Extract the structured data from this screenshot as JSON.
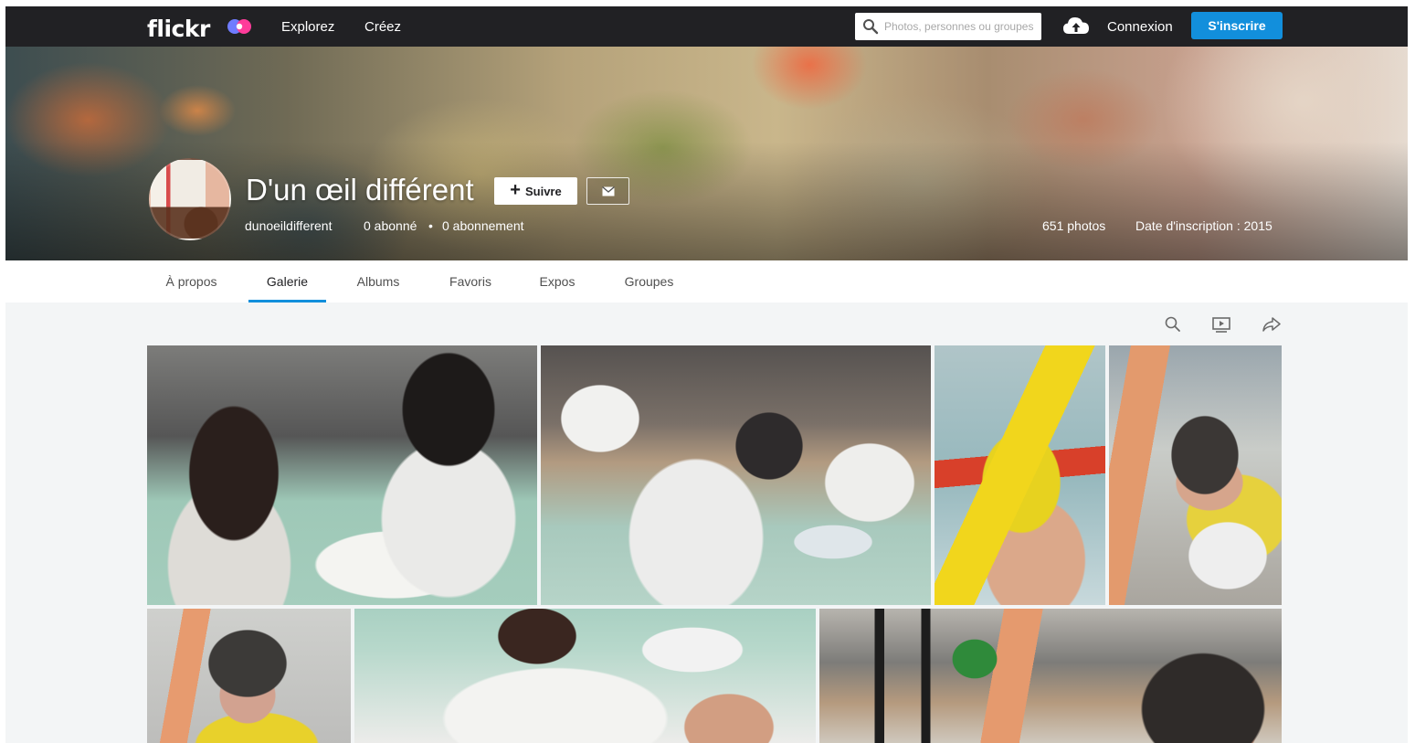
{
  "nav": {
    "logo": "flickr",
    "links": [
      "Explorez",
      "Créez"
    ],
    "search_placeholder": "Photos, personnes ou groupes",
    "login": "Connexion",
    "signup": "S'inscrire"
  },
  "profile": {
    "name": "D'un œil différent",
    "follow_label": "Suivre",
    "username": "dunoeildifferent",
    "followers": "0 abonné",
    "separator": "•",
    "following": "0 abonnement",
    "photos": "651 photos",
    "joined": "Date d'inscription : 2015"
  },
  "tabs": [
    "À propos",
    "Galerie",
    "Albums",
    "Favoris",
    "Expos",
    "Groupes"
  ],
  "active_tab": "Galerie",
  "gallery_tools": [
    "search-icon",
    "slideshow-icon",
    "share-icon"
  ],
  "colors": {
    "nav_bg": "#212124",
    "accent": "#128fdc",
    "gallery_bg": "#f3f5f6"
  }
}
